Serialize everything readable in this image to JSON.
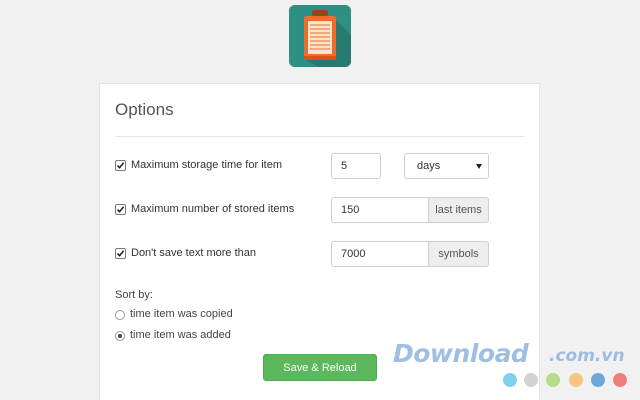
{
  "app": {
    "icon": "clipboard-icon"
  },
  "options": {
    "title": "Options",
    "storage_time": {
      "checked": true,
      "label": "Maximum storage time for item",
      "value": "5",
      "unit_selected": "days"
    },
    "stored_items": {
      "checked": true,
      "label": "Maximum number of stored items",
      "value": "150",
      "addon": "last items"
    },
    "text_limit": {
      "checked": true,
      "label": "Don't save text more than",
      "value": "7000",
      "addon": "symbols"
    },
    "sort": {
      "label": "Sort by:",
      "options": [
        {
          "label": "time item was copied",
          "selected": false
        },
        {
          "label": "time item was added",
          "selected": true
        }
      ]
    },
    "save_button": "Save & Reload"
  },
  "watermark": {
    "text": "Download",
    "suffix": ".com.vn",
    "dot_colors": [
      "#7fd0ef",
      "#d3d3d3",
      "#b8dc8b",
      "#f6c57f",
      "#6ea7d9",
      "#f07d7d"
    ]
  },
  "colors": {
    "background": "#f1f1f1",
    "icon_bg": "#2e8f83",
    "clipboard_orange": "#f26b2a",
    "save_green": "#5cb85c"
  }
}
